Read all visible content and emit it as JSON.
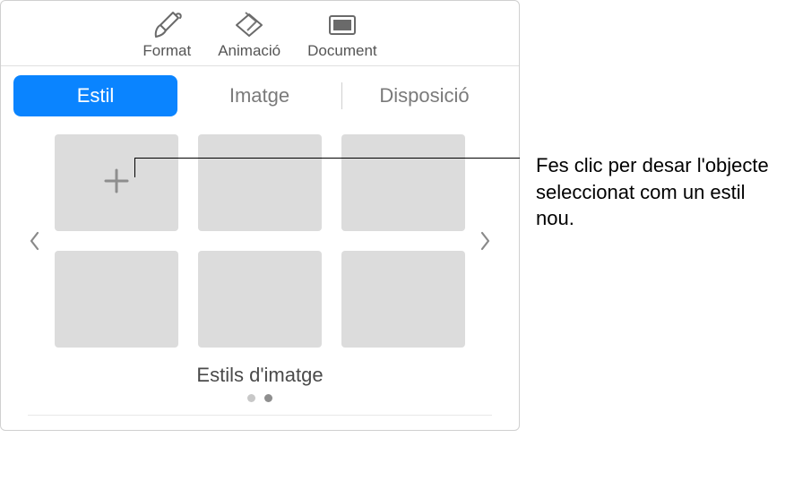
{
  "toolbar": {
    "items": [
      {
        "label": "Format"
      },
      {
        "label": "Animació"
      },
      {
        "label": "Document"
      }
    ]
  },
  "segmented": {
    "items": [
      {
        "label": "Estil",
        "active": true
      },
      {
        "label": "Imatge",
        "active": false
      },
      {
        "label": "Disposició",
        "active": false
      }
    ]
  },
  "styles": {
    "title": "Estils d'imatge",
    "add_aria": "Afegir estil",
    "page_count": 2,
    "active_page": 2
  },
  "callout": {
    "text": "Fes clic per desar l'objecte seleccionat com un estil nou."
  }
}
